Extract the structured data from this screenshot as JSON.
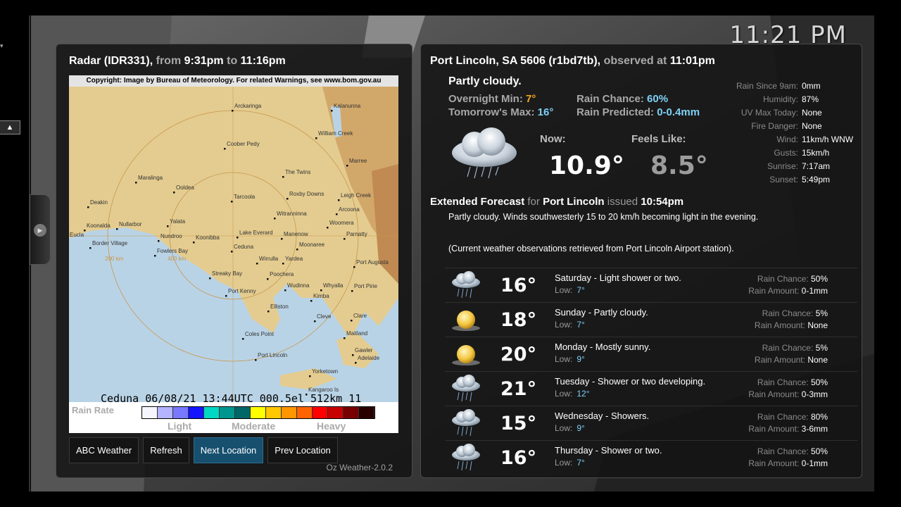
{
  "clock": "11:21 PM",
  "radar": {
    "label": "Radar (IDR331),",
    "from_word": "from",
    "from_time": "9:31pm",
    "to_word": "to",
    "to_time": "11:16pm",
    "copyright": "Copyright: Image by Bureau of Meteorology. For related Warnings, see www.bom.gov.au",
    "status_line": "Ceduna  06/08/21 13:44UTC 000.5el 512km 11",
    "legend_title": "Rain Rate",
    "legend_light": "Light",
    "legend_moderate": "Moderate",
    "legend_heavy": "Heavy",
    "legend_colors": [
      "#f5f5ff",
      "#b4b4ff",
      "#7878ff",
      "#1414ff",
      "#00d8c3",
      "#009690",
      "#006666",
      "#ffff00",
      "#ffc800",
      "#ff9600",
      "#ff6400",
      "#ff0000",
      "#c80000",
      "#780000",
      "#280000"
    ],
    "places": [
      "Arckaringa",
      "Kalanunna",
      "Coober Pedy",
      "William Creek",
      "Marree",
      "Maralinga",
      "Ooldea",
      "The Twins",
      "Tarcoola",
      "Roxby Downs",
      "Leigh Creek",
      "Deakin",
      "Arcoona",
      "Nullarbor",
      "Yalata",
      "Woomera",
      "Koonalda",
      "Witranninna",
      "Eucla",
      "Nundroo",
      "Koonibba",
      "Lake Everard",
      "Manenow",
      "Parnatty",
      "Border Village",
      "Ceduna",
      "Moonaree",
      "Fowlers Bay",
      "Wirrulla",
      "Yardea",
      "Port Augusta",
      "Streaky Bay",
      "Poochera",
      "Wudinna",
      "Whyalla",
      "Port Pirie",
      "Port Kenny",
      "Kimba",
      "Elliston",
      "Cleve",
      "Clare",
      "Coles Point",
      "Maitland",
      "Gawler",
      "Port Lincoln",
      "Adelaide",
      "Yorketown",
      "Kangaroo Is",
      "200 km",
      "400 km"
    ]
  },
  "buttons": {
    "abc": "ABC Weather",
    "refresh": "Refresh",
    "next": "Next Location",
    "prev": "Prev Location"
  },
  "version": "Oz Weather-2.0.2",
  "location": {
    "name": "Port Lincoln, SA 5606 (r1bd7tb),",
    "observed_word": "observed at",
    "observed_time": "11:01pm"
  },
  "current": {
    "summary": "Partly cloudy.",
    "overnight_label": "Overnight Min:",
    "overnight_value": "7°",
    "tomorrow_label": "Tomorrow's Max:",
    "tomorrow_value": "16°",
    "rain_chance_label": "Rain Chance:",
    "rain_chance_value": "60%",
    "rain_pred_label": "Rain Predicted:",
    "rain_pred_value": "0-0.4mm",
    "now_label": "Now:",
    "now_value": "10.9°",
    "feels_label": "Feels Like:",
    "feels_value": "8.5°",
    "icon": "cloud-rain-icon"
  },
  "observations": [
    {
      "k": "Rain Since 9am:",
      "v": "0mm"
    },
    {
      "k": "Humidity:",
      "v": "87%"
    },
    {
      "k": "UV Max Today:",
      "v": "None"
    },
    {
      "k": "Fire Danger:",
      "v": "None"
    },
    {
      "k": "Wind:",
      "v": "11km/h WNW"
    },
    {
      "k": "Gusts:",
      "v": "15km/h"
    },
    {
      "k": "Sunrise:",
      "v": "7:17am"
    },
    {
      "k": "Sunset:",
      "v": "5:49pm"
    }
  ],
  "extended": {
    "label": "Extended Forecast",
    "for_word": "for",
    "place": "Port Lincoln",
    "issued_word": "issued",
    "issued_time": "10:54pm",
    "text": "Partly cloudy. Winds southwesterly 15 to 20 km/h becoming light in the evening.",
    "note": "(Current weather observations retrieved from Port Lincoln Airport station)."
  },
  "forecast": [
    {
      "temp": "16°",
      "desc": "Saturday - Light shower or two.",
      "low_label": "Low:",
      "low": "7°",
      "rc_label": "Rain Chance:",
      "rc": "50%",
      "ra_label": "Rain Amount:",
      "ra": "0-1mm",
      "icon": "rain-cloud-icon"
    },
    {
      "temp": "18°",
      "desc": "Sunday - Partly cloudy.",
      "low_label": "Low:",
      "low": "7°",
      "rc_label": "Rain Chance:",
      "rc": "5%",
      "ra_label": "Rain Amount:",
      "ra": "None",
      "icon": "sun-icon"
    },
    {
      "temp": "20°",
      "desc": "Monday - Mostly sunny.",
      "low_label": "Low:",
      "low": "9°",
      "rc_label": "Rain Chance:",
      "rc": "5%",
      "ra_label": "Rain Amount:",
      "ra": "None",
      "icon": "sun-icon"
    },
    {
      "temp": "21°",
      "desc": "Tuesday - Shower or two developing.",
      "low_label": "Low:",
      "low": "12°",
      "rc_label": "Rain Chance:",
      "rc": "50%",
      "ra_label": "Rain Amount:",
      "ra": "0-3mm",
      "icon": "rain-cloud-icon"
    },
    {
      "temp": "15°",
      "desc": "Wednesday - Showers.",
      "low_label": "Low:",
      "low": "9°",
      "rc_label": "Rain Chance:",
      "rc": "80%",
      "ra_label": "Rain Amount:",
      "ra": "3-6mm",
      "icon": "rain-cloud-icon"
    },
    {
      "temp": "16°",
      "desc": "Thursday - Shower or two.",
      "low_label": "Low:",
      "low": "7°",
      "rc_label": "Rain Chance:",
      "rc": "50%",
      "ra_label": "Rain Amount:",
      "ra": "0-1mm",
      "icon": "rain-cloud-icon"
    }
  ]
}
